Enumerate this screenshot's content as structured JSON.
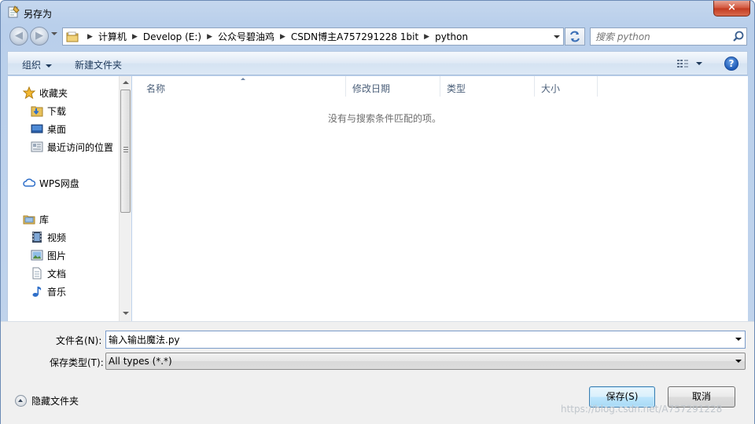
{
  "window": {
    "title": "另存为",
    "close_glyph": "×"
  },
  "address": {
    "breadcrumbs": [
      "计算机",
      "Develop (E:)",
      "公众号碧油鸡",
      "CSDN博主A757291228 1bit",
      "python"
    ],
    "search_placeholder": "搜索 python"
  },
  "toolbar": {
    "organize_label": "组织",
    "new_folder_label": "新建文件夹",
    "help_glyph": "?"
  },
  "nav": {
    "favorites": {
      "label": "收藏夹"
    },
    "downloads": {
      "label": "下载"
    },
    "desktop": {
      "label": "桌面"
    },
    "recent": {
      "label": "最近访问的位置"
    },
    "wps": {
      "label": "WPS网盘"
    },
    "libraries": {
      "label": "库"
    },
    "videos": {
      "label": "视频"
    },
    "pictures": {
      "label": "图片"
    },
    "documents": {
      "label": "文档"
    },
    "music": {
      "label": "音乐"
    }
  },
  "columns": {
    "name": "名称",
    "date": "修改日期",
    "type": "类型",
    "size": "大小"
  },
  "empty_message": "没有与搜索条件匹配的项。",
  "form": {
    "filename_label": "文件名(N):",
    "filename_value": "输入输出魔法.py",
    "filetype_label": "保存类型(T):",
    "filetype_value": "All types (*.*)",
    "hide_folders_label": "隐藏文件夹",
    "save_label": "保存(S)",
    "cancel_label": "取消"
  },
  "watermark": "https://blog.csdn.net/A757291228",
  "colors": {
    "accent": "#3c7fb1",
    "frame": "#c2d5ec",
    "close": "#c23a20"
  }
}
